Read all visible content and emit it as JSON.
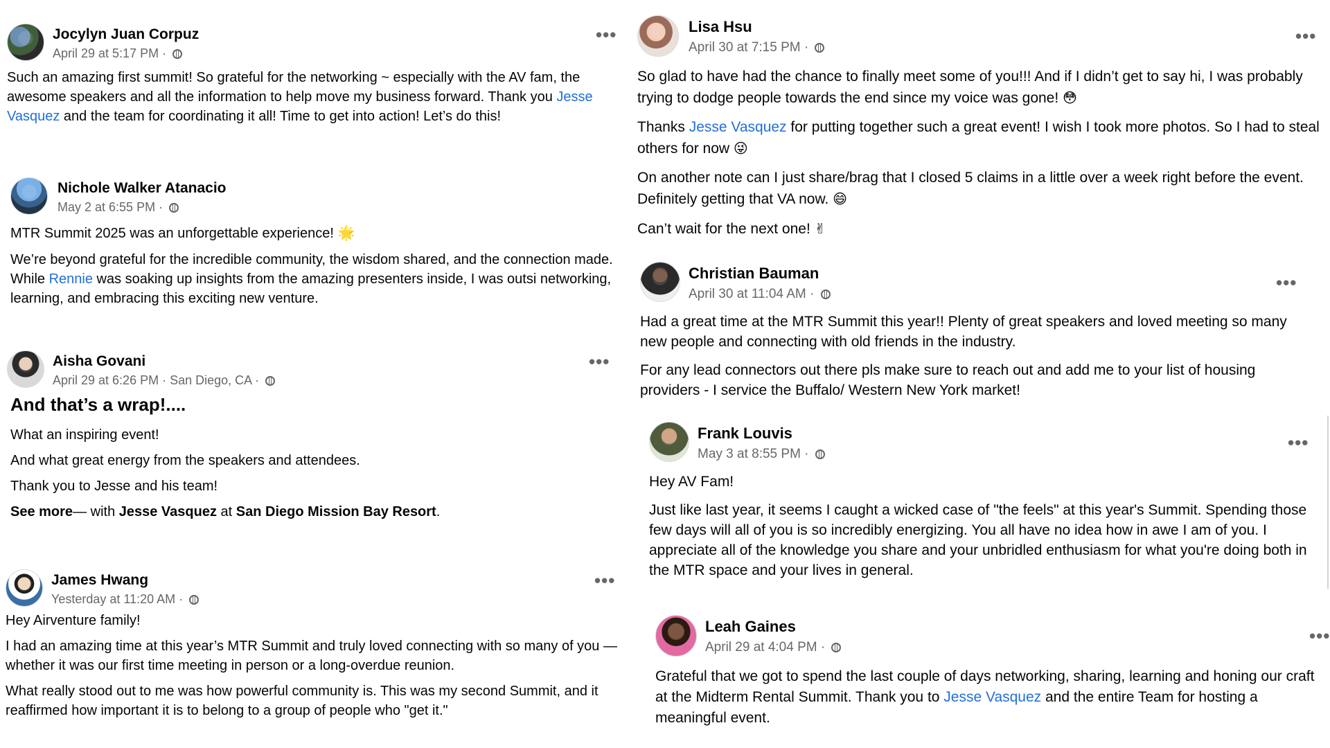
{
  "posts": [
    {
      "name": "Jocylyn Juan Corpuz",
      "time": "April 29 at 5:17 PM",
      "body_pre": "Such an amazing first summit!  So grateful for the networking ~ especially with the AV fam, the awesome speakers and all the information to help move my business forward. Thank you ",
      "link": "Jesse Vasquez",
      "body_post": " and the team for coordinating it all!  Time to get into action!  Let’s do this!"
    },
    {
      "name": "Nichole Walker Atanacio",
      "time": "May 2 at 6:55 PM",
      "p1": "MTR Summit 2025 was an unforgettable experience!",
      "p1_emoji": "🌟",
      "p2_pre": "We’re beyond grateful for the incredible community, the wisdom shared, and the connection made. While ",
      "link": "Rennie",
      "p2_post": " was soaking up insights from the amazing presenters inside, I was outsi networking, learning, and embracing this exciting new venture."
    },
    {
      "name": "Aisha Govani",
      "time": "April 29 at 6:26 PM",
      "location": "San Diego, CA",
      "headline": "And that’s a wrap!....",
      "lines": [
        "What an inspiring event!",
        "And what great energy from the speakers and attendees.",
        "Thank you to Jesse and his team!"
      ],
      "see_more": "See more",
      "with_text": "— with ",
      "with_person": "Jesse Vasquez",
      "at_text": " at ",
      "place": "San Diego Mission Bay Resort",
      "end": "."
    },
    {
      "name": "James Hwang",
      "time": "Yesterday at 11:20 AM",
      "p1": "Hey Airventure family!",
      "p2": "I had an amazing time at this year’s MTR Summit and truly loved connecting with so many of you — whether it was our first time meeting in person or a long-overdue reunion.",
      "p3": "What really stood out to me was how powerful community is. This was my second Summit, and it reaffirmed how important it is to belong to a group of people who \"get it.\""
    },
    {
      "name": "Lisa Hsu",
      "time": "April 30 at 7:15 PM",
      "p1": "So glad to have had the chance to finally meet some of you!!! And if I didn’t get to say hi, I was probably trying to dodge people towards the end since my voice was gone!",
      "p1_emoji": "😳",
      "p2_pre": "Thanks ",
      "link": "Jesse Vasquez",
      "p2_post": " for putting together such a great event! I wish I took more photos. So I had to steal others for now",
      "p2_emoji": "😜",
      "p3": "On another note can I just share/brag that I closed 5 claims in a little over a week right before the event. Definitely getting that VA now.",
      "p3_emoji": "😄",
      "p4": "Can’t wait for the next one!",
      "p4_emoji": "✌"
    },
    {
      "name": "Christian Bauman",
      "time": "April 30 at 11:04 AM",
      "p1": "Had a great time at the MTR Summit this year!! Plenty of great speakers and loved meeting so many new people and connecting with old friends in the industry.",
      "p2": "For any lead connectors out there pls make sure to reach out and add me to your list of housing providers - I service the Buffalo/ Western New York market!"
    },
    {
      "name": "Frank Louvis",
      "time": "May 3 at 8:55 PM",
      "p1": "Hey AV Fam!",
      "p2": "Just like last year, it seems I caught a wicked case of \"the feels\" at this year's Summit. Spending those few days will all of you is so incredibly energizing. You all have no idea how in awe I am of you. I appreciate all of the knowledge you share and your unbridled enthusiasm for what you're doing both in the MTR space and your lives in general."
    },
    {
      "name": "Leah Gaines",
      "time": "April 29 at 4:04 PM",
      "body_pre": "Grateful that we got to spend the last couple of days networking, sharing,  learning and honing our craft at the Midterm Rental Summit. Thank you to ",
      "link": "Jesse Vasquez",
      "body_post": " and the entire Team for hosting a meaningful event."
    }
  ],
  "separator": " · ",
  "more_glyph": "•••"
}
